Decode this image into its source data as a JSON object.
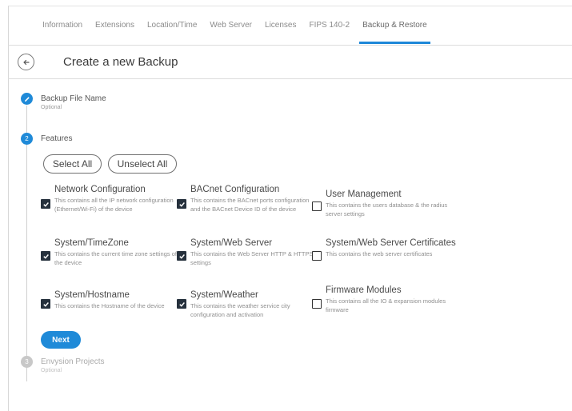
{
  "tabs": [
    {
      "label": "Information"
    },
    {
      "label": "Extensions"
    },
    {
      "label": "Location/Time"
    },
    {
      "label": "Web Server"
    },
    {
      "label": "Licenses"
    },
    {
      "label": "FIPS 140-2"
    },
    {
      "label": "Backup & Restore"
    }
  ],
  "header": {
    "title": "Create a new Backup",
    "back_icon": "arrow-left-icon"
  },
  "steps": [
    {
      "number": "1",
      "title": "Backup File Name",
      "subtitle": "Optional",
      "icon": "pencil-icon"
    },
    {
      "number": "2",
      "title": "Features"
    },
    {
      "number": "3",
      "title": "Envysion Projects",
      "subtitle": "Optional"
    }
  ],
  "actions": {
    "select_all": "Select All",
    "unselect_all": "Unselect All",
    "next": "Next"
  },
  "features": [
    {
      "title": "Network Configuration",
      "description": "This contains all the IP network configuration (Ethernet/Wi-Fi) of the device",
      "checked": true
    },
    {
      "title": "BACnet Configuration",
      "description": "This contains the BACnet ports configuration and the BACnet Device ID of the device",
      "checked": true
    },
    {
      "title": "User Management",
      "description": "This contains the users database & the radius server settings",
      "checked": false
    },
    {
      "title": "System/TimeZone",
      "description": "This contains the current time zone settings of the device",
      "checked": true
    },
    {
      "title": "System/Web Server",
      "description": "This contains the Web Server HTTP & HTTPS settings",
      "checked": true
    },
    {
      "title": "System/Web Server Certificates",
      "description": "This contains the web server certificates",
      "checked": false
    },
    {
      "title": "System/Hostname",
      "description": "This contains the Hostname of the device",
      "checked": true
    },
    {
      "title": "System/Weather",
      "description": "This contains the weather service city configuration and activation",
      "checked": true
    },
    {
      "title": "Firmware Modules",
      "description": "This contains all the IO & expansion modules firmware",
      "checked": false
    }
  ],
  "colors": {
    "accent": "#1f8ad8",
    "checkbox_checked": "#26313d"
  }
}
